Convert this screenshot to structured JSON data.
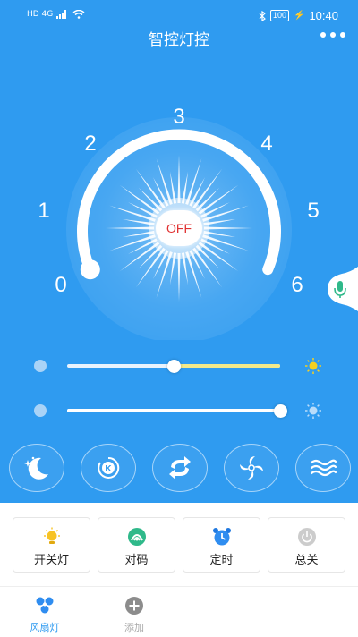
{
  "status_bar": {
    "network_left": "HD 4G",
    "battery": "100",
    "time": "10:40"
  },
  "header": {
    "title": "智控灯控",
    "more_icon": "more-dots-icon"
  },
  "dial": {
    "scale_labels": [
      "0",
      "1",
      "2",
      "3",
      "4",
      "5",
      "6"
    ],
    "power_label": "OFF",
    "level": 0
  },
  "sliders": [
    {
      "name": "brightness",
      "value": 0.5,
      "end_icon": "sun-icon"
    },
    {
      "name": "color-temperature",
      "value": 1.0,
      "end_icon": "sun-icon"
    }
  ],
  "modes": [
    {
      "name": "night-mode",
      "icon": "moon-stars-icon"
    },
    {
      "name": "k-mode",
      "icon": "k-circle-icon"
    },
    {
      "name": "cycle-mode",
      "icon": "refresh-arrows-icon"
    },
    {
      "name": "fan-mode",
      "icon": "fan-swirl-icon"
    },
    {
      "name": "wave-mode",
      "icon": "wave-icon"
    }
  ],
  "actions": [
    {
      "label": "开关灯",
      "icon": "lightbulb-icon"
    },
    {
      "label": "对码",
      "icon": "pairing-icon"
    },
    {
      "label": "定时",
      "icon": "alarm-clock-icon"
    },
    {
      "label": "总关",
      "icon": "power-icon"
    }
  ],
  "tabs": [
    {
      "label": "风扇灯",
      "icon": "fan-light-icon",
      "active": true
    },
    {
      "label": "添加",
      "icon": "add-icon",
      "active": false
    }
  ],
  "colors": {
    "primary_blue": "#2f9bf0",
    "off_red": "#e03030",
    "slider_yellow": "#f3e98a",
    "active_tab": "#2f9bf0"
  }
}
